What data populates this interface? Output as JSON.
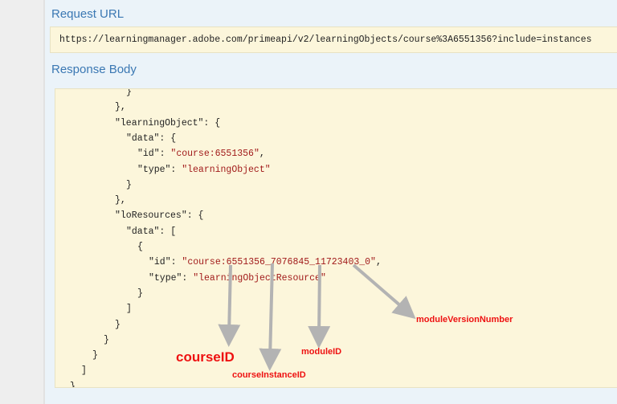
{
  "request_url": {
    "title": "Request URL",
    "url": "https://learningmanager.adobe.com/primeapi/v2/learningObjects/course%3A6551356?include=instances"
  },
  "response_body": {
    "title": "Response Body",
    "lines": [
      {
        "indent": 10,
        "parts": [
          [
            "p",
            "}"
          ]
        ]
      },
      {
        "indent": 8,
        "parts": [
          [
            "p",
            "},"
          ]
        ]
      },
      {
        "indent": 8,
        "parts": [
          [
            "p",
            "\"learningObject\": {"
          ]
        ]
      },
      {
        "indent": 10,
        "parts": [
          [
            "p",
            "\"data\": {"
          ]
        ]
      },
      {
        "indent": 12,
        "parts": [
          [
            "p",
            "\"id\": "
          ],
          [
            "s",
            "\"course:6551356\""
          ],
          [
            "p",
            ","
          ]
        ]
      },
      {
        "indent": 12,
        "parts": [
          [
            "p",
            "\"type\": "
          ],
          [
            "s",
            "\"learningObject\""
          ]
        ]
      },
      {
        "indent": 10,
        "parts": [
          [
            "p",
            "}"
          ]
        ]
      },
      {
        "indent": 8,
        "parts": [
          [
            "p",
            "},"
          ]
        ]
      },
      {
        "indent": 8,
        "parts": [
          [
            "p",
            "\"loResources\": {"
          ]
        ]
      },
      {
        "indent": 10,
        "parts": [
          [
            "p",
            "\"data\": ["
          ]
        ]
      },
      {
        "indent": 12,
        "parts": [
          [
            "p",
            "{"
          ]
        ]
      },
      {
        "indent": 14,
        "parts": [
          [
            "p",
            "\"id\": "
          ],
          [
            "s",
            "\"course:6551356_7076845_11723403_0\""
          ],
          [
            "p",
            ","
          ]
        ]
      },
      {
        "indent": 14,
        "parts": [
          [
            "p",
            "\"type\": "
          ],
          [
            "s",
            "\"learningObjectResource\""
          ]
        ]
      },
      {
        "indent": 12,
        "parts": [
          [
            "p",
            "}"
          ]
        ]
      },
      {
        "indent": 10,
        "parts": [
          [
            "p",
            "]"
          ]
        ]
      },
      {
        "indent": 8,
        "parts": [
          [
            "p",
            "}"
          ]
        ]
      },
      {
        "indent": 6,
        "parts": [
          [
            "p",
            "}"
          ]
        ]
      },
      {
        "indent": 4,
        "parts": [
          [
            "p",
            "}"
          ]
        ]
      },
      {
        "indent": 2,
        "parts": [
          [
            "p",
            "]"
          ]
        ]
      },
      {
        "indent": 0,
        "parts": [
          [
            "p",
            "}"
          ]
        ]
      }
    ]
  },
  "annotations": {
    "course_id": "courseID",
    "course_instance_id": "courseInstanceID",
    "module_id": "moduleID",
    "module_version_number": "moduleVersionNumber"
  },
  "colors": {
    "title": "#3b78b3",
    "string": "#a11a1a",
    "annotation": "#ee1111",
    "arrow": "#b3b3b3",
    "box_bg": "#fcf6db"
  }
}
